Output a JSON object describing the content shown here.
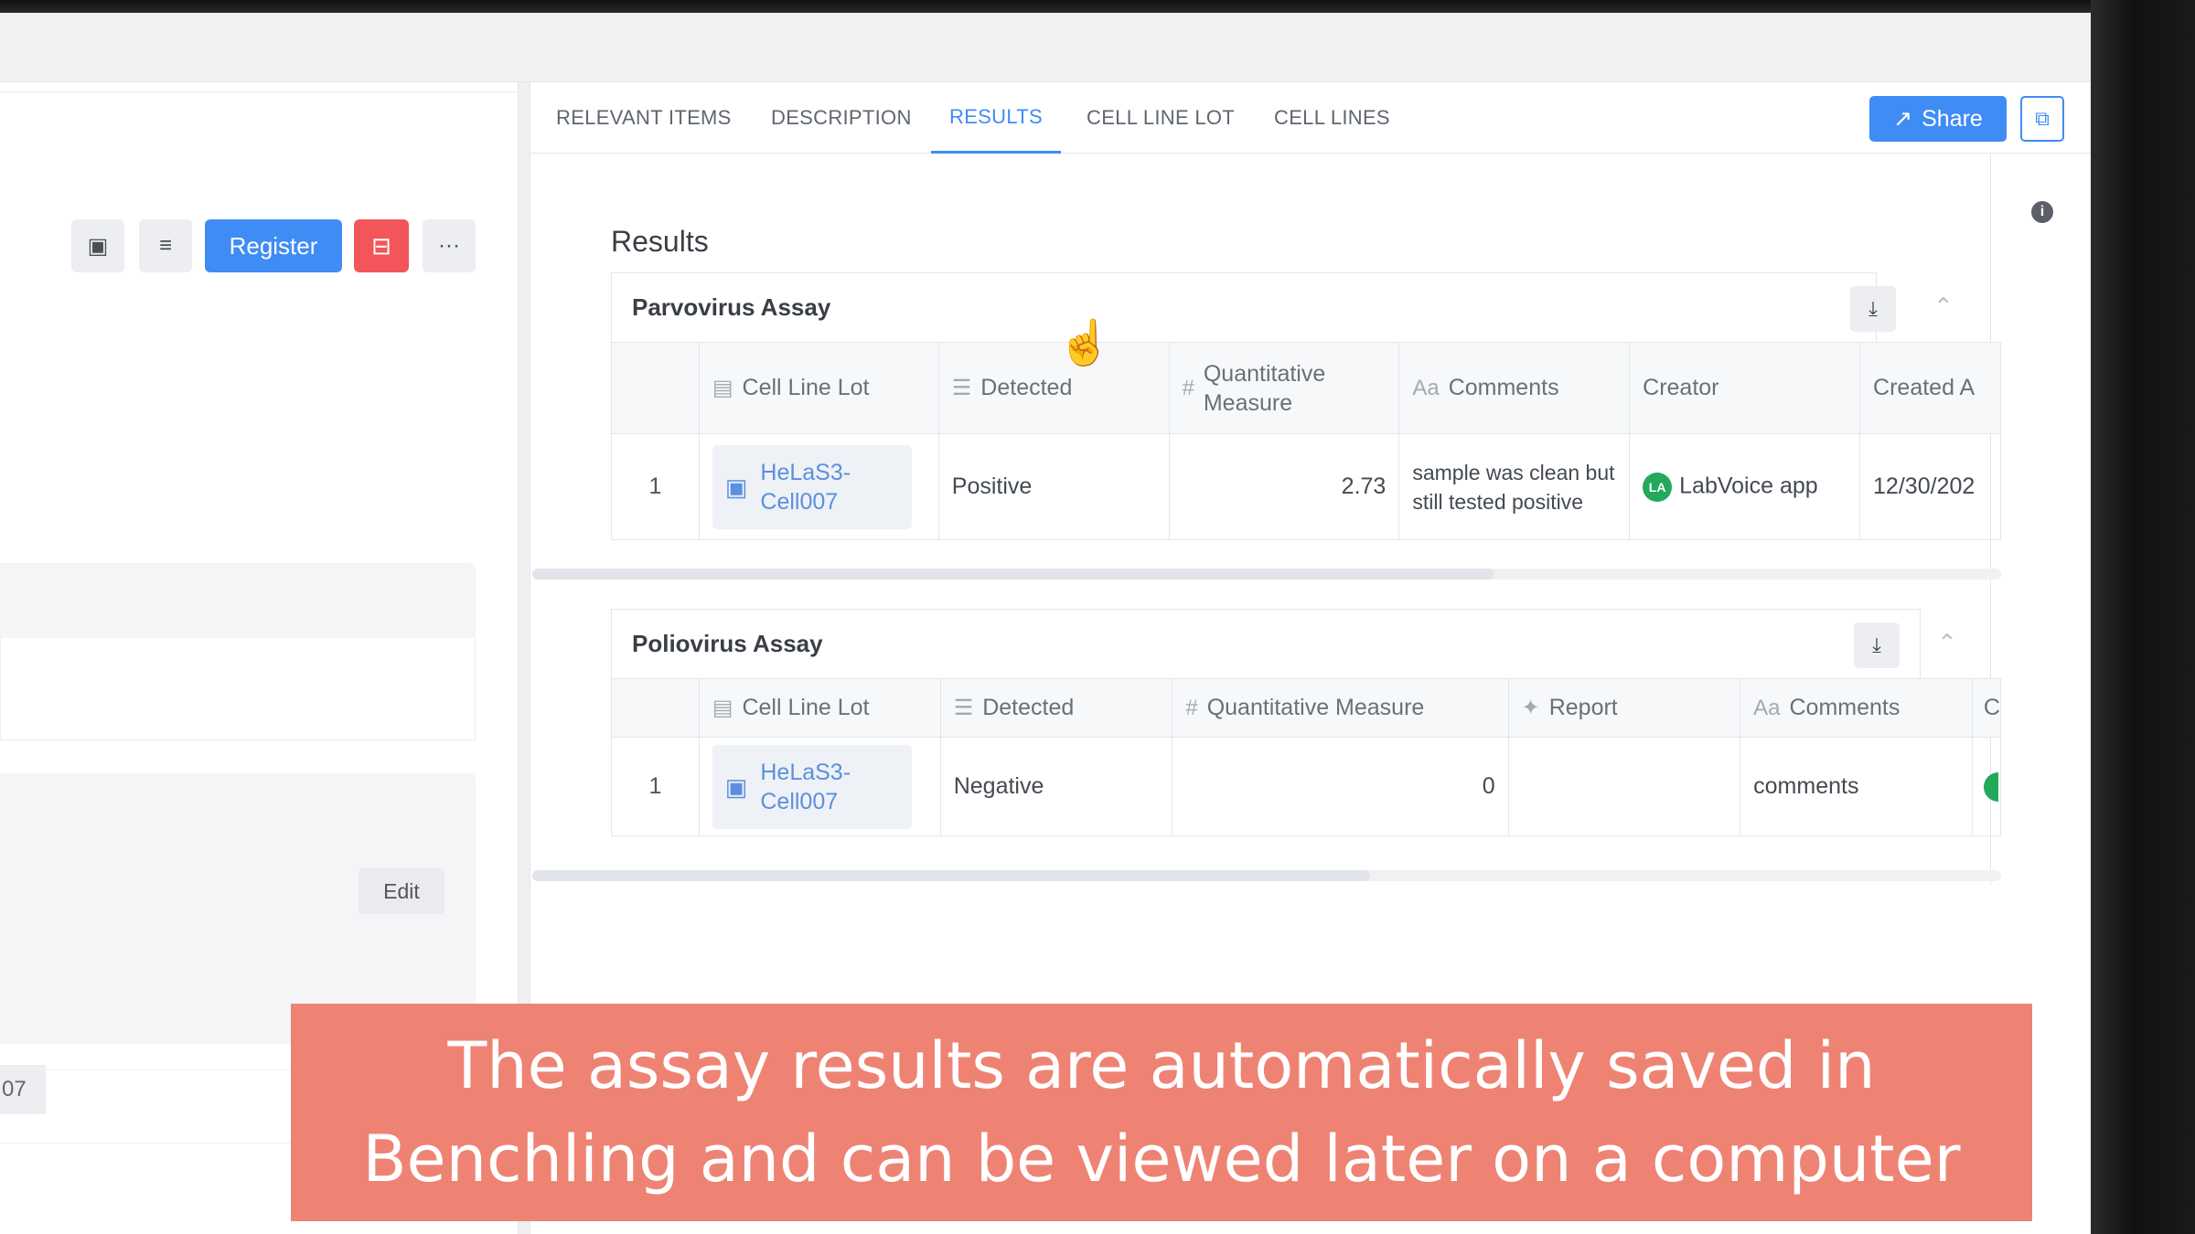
{
  "left_toolbar": {
    "register_label": "Register",
    "more_label": "···",
    "edit_label": "Edit",
    "partial_id": "07"
  },
  "tabs": [
    {
      "label": "RELEVANT ITEMS"
    },
    {
      "label": "DESCRIPTION"
    },
    {
      "label": "RESULTS",
      "active": true
    },
    {
      "label": "CELL LINE LOT"
    },
    {
      "label": "CELL LINES"
    }
  ],
  "share_label": "Share",
  "results_title": "Results",
  "assay1": {
    "title": "Parvovirus Assay",
    "headers": [
      "Cell Line Lot",
      "Detected",
      "Quantitative Measure",
      "Comments",
      "Creator",
      "Created A"
    ],
    "rows": [
      {
        "num": "1",
        "lot": "HeLaS3-Cell007",
        "detected": "Positive",
        "measure": "2.73",
        "comments": "sample was clean but still tested positive",
        "creator": "LabVoice app",
        "created": "12/30/202"
      }
    ],
    "avatar_initials": "LA"
  },
  "assay2": {
    "title": "Poliovirus Assay",
    "headers": [
      "Cell Line Lot",
      "Detected",
      "Quantitative Measure",
      "Report",
      "Comments",
      "C"
    ],
    "rows": [
      {
        "num": "1",
        "lot": "HeLaS3-Cell007",
        "detected": "Negative",
        "measure": "0",
        "report": "",
        "comments": "comments"
      }
    ]
  },
  "caption": {
    "line1": "The assay results are automatically saved in",
    "line2": "Benchling and can be viewed later on a computer"
  },
  "colors": {
    "accent": "#3f8cf5",
    "danger": "#f2555a",
    "caption_bg": "#ee8374",
    "creator_avatar": "#22a95a"
  }
}
